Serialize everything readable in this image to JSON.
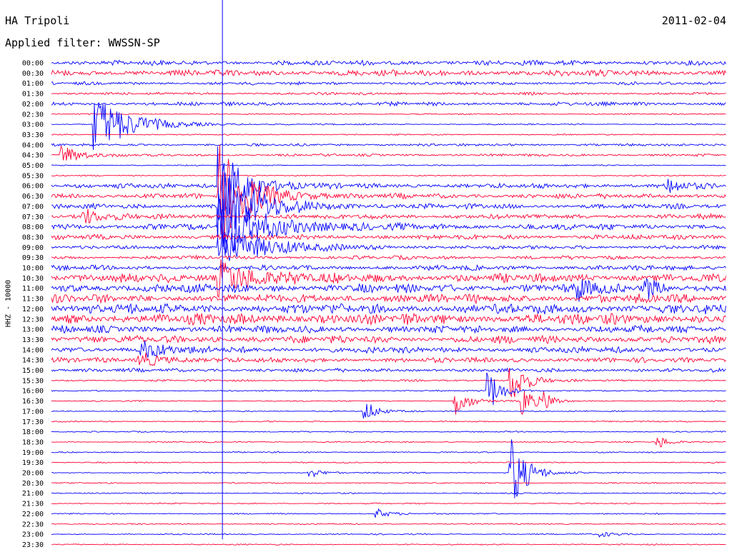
{
  "header": {
    "station": "HA Tripoli",
    "filter": "Applied filter: WWSSN-SP",
    "date": "2011-02-04"
  },
  "axis": {
    "ylabel": "HHZ - 10000"
  },
  "colors": {
    "trace_a": "#0000ff",
    "trace_b": "#ff0033",
    "marker": "#0000ff"
  },
  "chart_data": {
    "type": "helicorder",
    "ylabel": "HHZ - 10000",
    "rows": [
      {
        "label": "00:00",
        "color": "blue",
        "amp": 4
      },
      {
        "label": "00:30",
        "color": "red",
        "amp": 5
      },
      {
        "label": "01:00",
        "color": "blue",
        "amp": 2.5
      },
      {
        "label": "01:30",
        "color": "red",
        "amp": 2
      },
      {
        "label": "02:00",
        "color": "blue",
        "amp": 3
      },
      {
        "label": "02:30",
        "color": "red",
        "amp": 1
      },
      {
        "label": "03:00",
        "color": "blue",
        "amp": 1
      },
      {
        "label": "03:30",
        "color": "red",
        "amp": 1
      },
      {
        "label": "04:00",
        "color": "blue",
        "amp": 2
      },
      {
        "label": "04:30",
        "color": "red",
        "amp": 2
      },
      {
        "label": "05:00",
        "color": "blue",
        "amp": 1
      },
      {
        "label": "05:30",
        "color": "red",
        "amp": 1
      },
      {
        "label": "06:00",
        "color": "blue",
        "amp": 4
      },
      {
        "label": "06:30",
        "color": "red",
        "amp": 4
      },
      {
        "label": "07:00",
        "color": "blue",
        "amp": 4
      },
      {
        "label": "07:30",
        "color": "red",
        "amp": 4
      },
      {
        "label": "08:00",
        "color": "blue",
        "amp": 5
      },
      {
        "label": "08:30",
        "color": "red",
        "amp": 4
      },
      {
        "label": "09:00",
        "color": "blue",
        "amp": 3
      },
      {
        "label": "09:30",
        "color": "red",
        "amp": 3
      },
      {
        "label": "10:00",
        "color": "blue",
        "amp": 4
      },
      {
        "label": "10:30",
        "color": "red",
        "amp": 7
      },
      {
        "label": "11:00",
        "color": "blue",
        "amp": 7
      },
      {
        "label": "11:30",
        "color": "red",
        "amp": 7
      },
      {
        "label": "12:00",
        "color": "blue",
        "amp": 8
      },
      {
        "label": "12:30",
        "color": "red",
        "amp": 9
      },
      {
        "label": "13:00",
        "color": "blue",
        "amp": 6
      },
      {
        "label": "13:30",
        "color": "red",
        "amp": 6
      },
      {
        "label": "14:00",
        "color": "blue",
        "amp": 5
      },
      {
        "label": "14:30",
        "color": "red",
        "amp": 4
      },
      {
        "label": "15:00",
        "color": "blue",
        "amp": 3
      },
      {
        "label": "15:30",
        "color": "red",
        "amp": 1.5
      },
      {
        "label": "16:00",
        "color": "blue",
        "amp": 1
      },
      {
        "label": "16:30",
        "color": "red",
        "amp": 1
      },
      {
        "label": "17:00",
        "color": "blue",
        "amp": 1
      },
      {
        "label": "17:30",
        "color": "red",
        "amp": 1
      },
      {
        "label": "18:00",
        "color": "blue",
        "amp": 1
      },
      {
        "label": "18:30",
        "color": "red",
        "amp": 1
      },
      {
        "label": "19:00",
        "color": "blue",
        "amp": 1
      },
      {
        "label": "19:30",
        "color": "red",
        "amp": 1
      },
      {
        "label": "20:00",
        "color": "blue",
        "amp": 1
      },
      {
        "label": "20:30",
        "color": "red",
        "amp": 1
      },
      {
        "label": "21:00",
        "color": "blue",
        "amp": 1
      },
      {
        "label": "21:30",
        "color": "red",
        "amp": 1
      },
      {
        "label": "22:00",
        "color": "blue",
        "amp": 1
      },
      {
        "label": "22:30",
        "color": "red",
        "amp": 1
      },
      {
        "label": "23:00",
        "color": "blue",
        "amp": 1
      },
      {
        "label": "23:30",
        "color": "red",
        "amp": 1
      }
    ],
    "events": [
      {
        "row": "03:00",
        "minute": 2,
        "peak": 40,
        "decay": 6
      },
      {
        "row": "04:30",
        "minute": 0.5,
        "peak": 14,
        "decay": 3
      },
      {
        "row": "07:30",
        "minute": 1.5,
        "peak": 10,
        "decay": 3
      },
      {
        "row": "06:00",
        "minute": 7.5,
        "peak": 60,
        "decay": 4
      },
      {
        "row": "06:30",
        "minute": 7.5,
        "peak": 70,
        "decay": 5
      },
      {
        "row": "07:00",
        "minute": 7.5,
        "peak": 60,
        "decay": 6
      },
      {
        "row": "08:00",
        "minute": 7.5,
        "peak": 50,
        "decay": 7
      },
      {
        "row": "09:00",
        "minute": 7.5,
        "peak": 28,
        "decay": 8
      },
      {
        "row": "10:30",
        "minute": 7.5,
        "peak": 25,
        "decay": 6
      },
      {
        "row": "14:00",
        "minute": 4,
        "peak": 12,
        "decay": 4
      },
      {
        "row": "14:30",
        "minute": 4,
        "peak": 10,
        "decay": 4
      },
      {
        "row": "16:30",
        "minute": 18,
        "peak": 22,
        "decay": 2
      },
      {
        "row": "16:00",
        "minute": 19.5,
        "peak": 28,
        "decay": 2
      },
      {
        "row": "15:30",
        "minute": 20.5,
        "peak": 30,
        "decay": 2.5
      },
      {
        "row": "16:30",
        "minute": 21,
        "peak": 20,
        "decay": 2
      },
      {
        "row": "16:30",
        "minute": 22,
        "peak": 10,
        "decay": 1.5
      },
      {
        "row": "17:00",
        "minute": 14,
        "peak": 14,
        "decay": 2
      },
      {
        "row": "18:30",
        "minute": 27,
        "peak": 9,
        "decay": 2
      },
      {
        "row": "20:00",
        "minute": 20.5,
        "peak": 50,
        "decay": 2.5
      },
      {
        "row": "20:00",
        "minute": 11.5,
        "peak": 7,
        "decay": 2
      },
      {
        "row": "22:00",
        "minute": 14.5,
        "peak": 7,
        "decay": 2
      },
      {
        "row": "23:00",
        "minute": 24.5,
        "peak": 4,
        "decay": 2
      },
      {
        "row": "06:00",
        "minute": 27.5,
        "peak": 12,
        "decay": 2
      },
      {
        "row": "11:00",
        "minute": 23.5,
        "peak": 16,
        "decay": 2
      },
      {
        "row": "11:00",
        "minute": 26.5,
        "peak": 14,
        "decay": 2
      }
    ],
    "marker_minute": 7.6
  }
}
